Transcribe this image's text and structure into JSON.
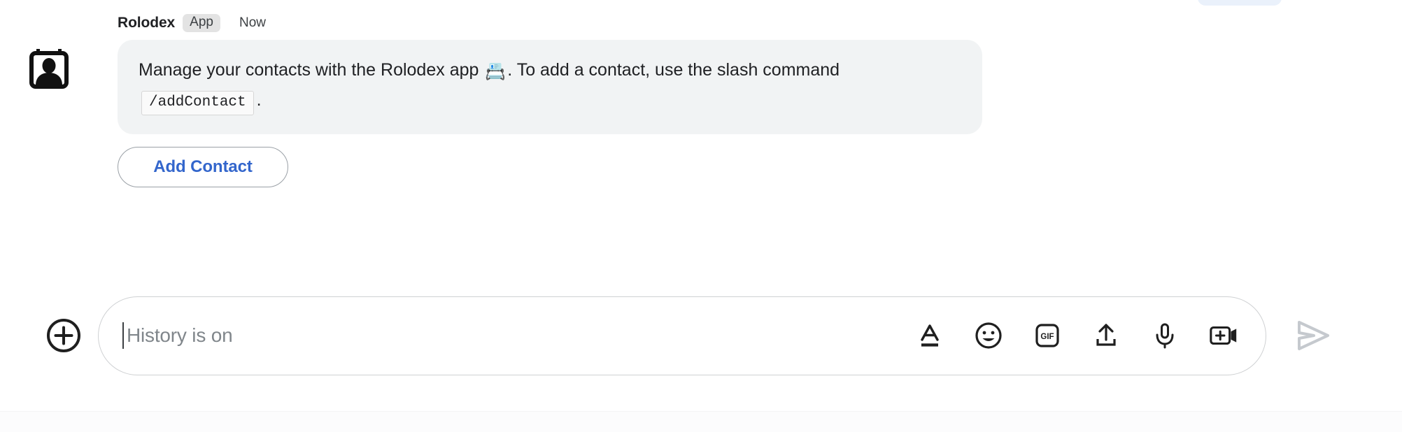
{
  "message": {
    "sender": "Rolodex",
    "badge": "App",
    "timestamp": "Now",
    "avatar_icon": "rolodex-contact-card-icon",
    "body_part1": "Manage your contacts with the Rolodex app ",
    "body_emoji": "📇",
    "body_part2": ". To add a contact, use the slash command ",
    "body_code": "/addContact",
    "body_part3": "."
  },
  "actions": {
    "add_contact_label": "Add Contact"
  },
  "composer": {
    "add_icon": "plus-circle-icon",
    "placeholder": "History is on",
    "input_value": "",
    "tools": [
      {
        "name": "format-text-icon",
        "label": "A"
      },
      {
        "name": "emoji-icon",
        "label": ""
      },
      {
        "name": "gif-icon",
        "label": "GIF"
      },
      {
        "name": "upload-file-icon",
        "label": ""
      },
      {
        "name": "microphone-icon",
        "label": ""
      },
      {
        "name": "add-video-icon",
        "label": ""
      }
    ],
    "send_icon": "send-arrow-icon"
  },
  "colors": {
    "accent_blue": "#3366cc",
    "bubble_bg": "#f1f3f4",
    "badge_bg": "#e3e3e3",
    "placeholder_text": "#80868b",
    "icon_stroke": "#1f1f1f",
    "send_disabled": "#c5c9ce",
    "clipped_pill": "#eaf1fb"
  }
}
